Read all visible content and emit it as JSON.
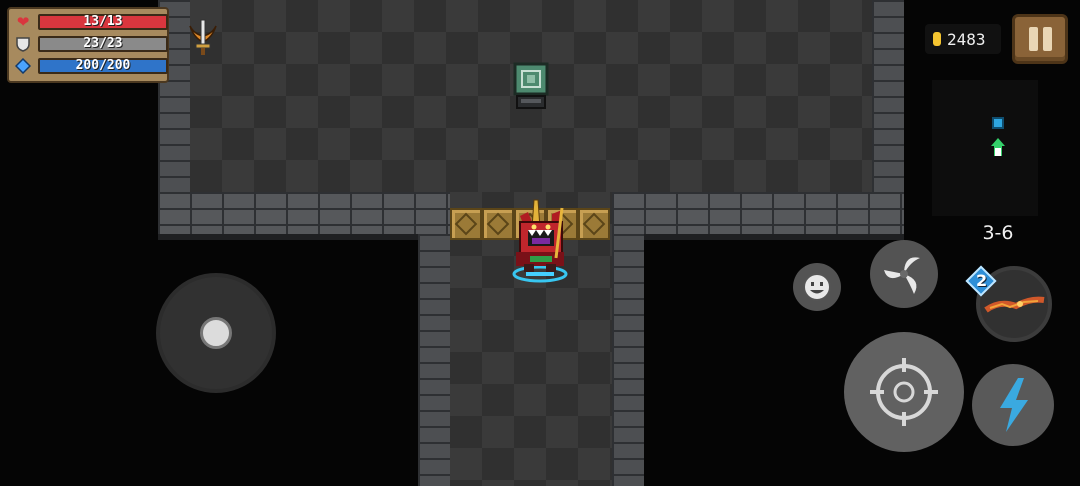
{
  "hud": {
    "health": "13/13",
    "armor": "23/23",
    "energy": "200/200",
    "health_icon": "heart-icon",
    "armor_icon": "shield-icon",
    "energy_icon": "diamond-icon",
    "health_color": "#d9363e",
    "armor_color": "#8a8a8a",
    "energy_color": "#2f74c9"
  },
  "gold": "2483",
  "level": "3-6",
  "weapon_energy_cost": "2",
  "colors": {
    "floor": "#3a3a3a",
    "wall": "#4d4f52",
    "gate": "#9b7a37",
    "accent_blue": "#3aa9e0"
  }
}
